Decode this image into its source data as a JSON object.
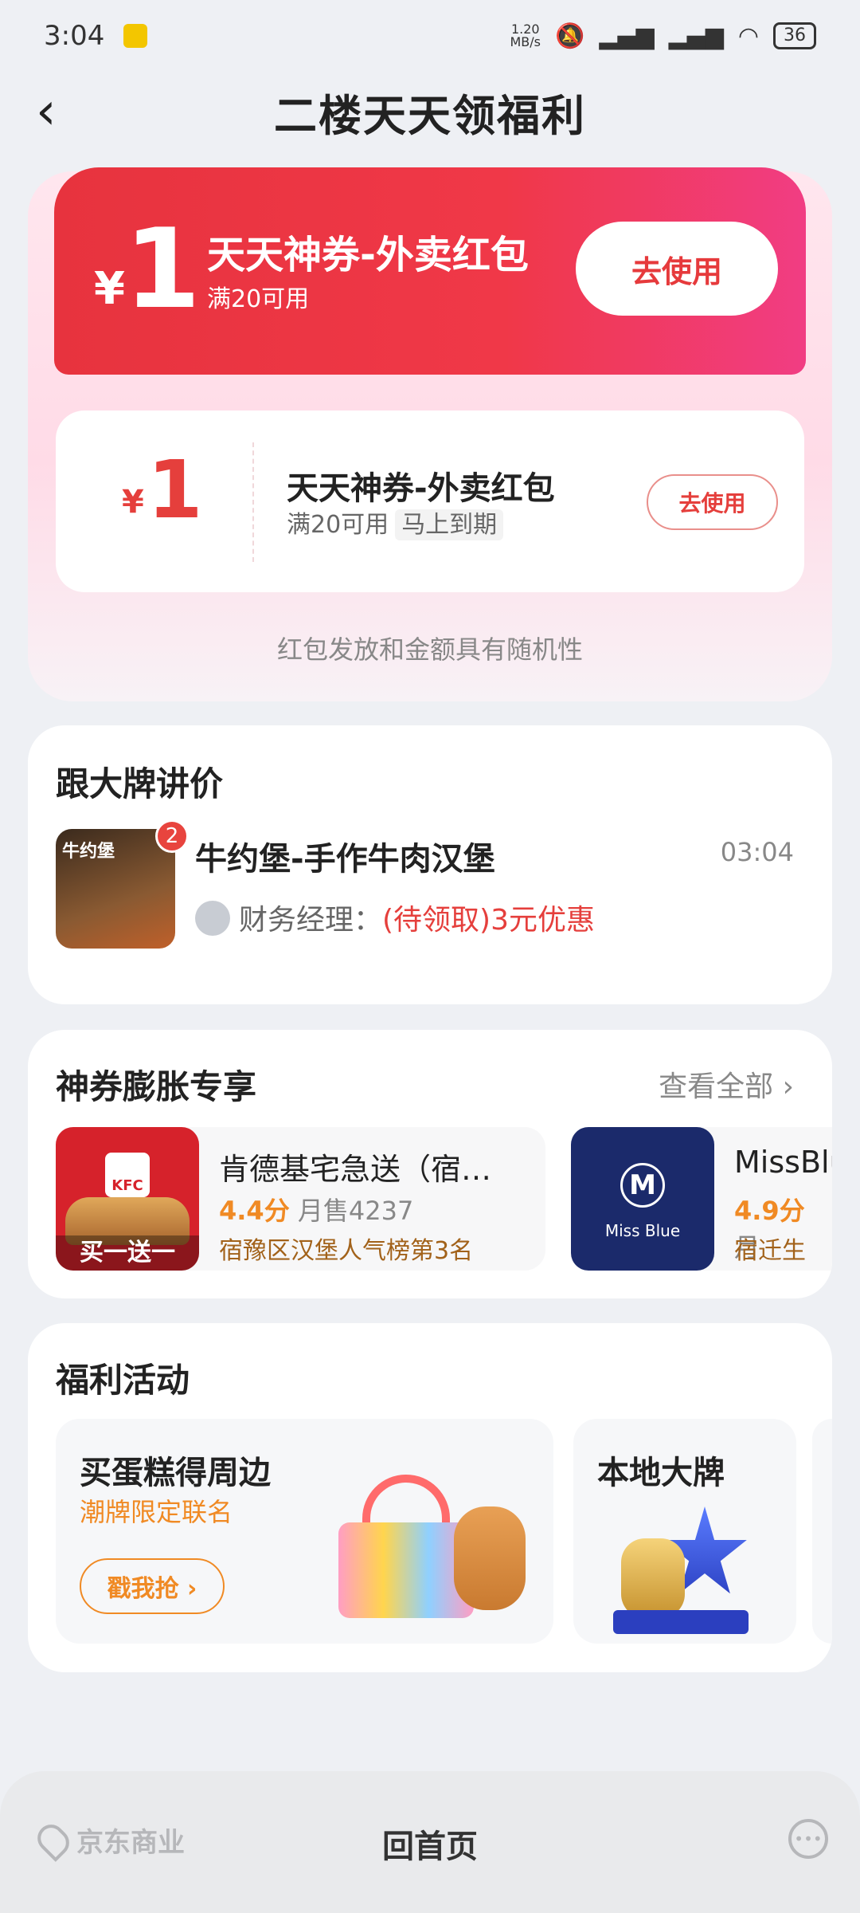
{
  "status_bar": {
    "time": "3:04",
    "net_speed": "1.20\nMB/s",
    "battery": "36"
  },
  "header": {
    "back_icon": "chevron-left-icon",
    "title": "二楼天天领福利"
  },
  "top_coupon": {
    "yen": "¥",
    "amount": "1",
    "name": "天天神券-外卖红包",
    "condition": "满20可用",
    "button": "去使用"
  },
  "second_coupon": {
    "yen": "¥",
    "amount": "1",
    "name": "天天神券-外卖红包",
    "condition": "满20可用",
    "tag": "马上到期",
    "button": "去使用"
  },
  "coupon_note": "红包发放和金额具有随机性",
  "brand_section": {
    "title": "跟大牌讲价",
    "item": {
      "badge": "2",
      "image_label": "牛约堡",
      "name": "牛约堡-手作牛肉汉堡",
      "time": "03:04",
      "sender": "财务经理：",
      "highlight": "(待领取)3元优惠"
    }
  },
  "shop_section": {
    "title": "神券膨胀专享",
    "see_all": "查看全部 ›",
    "shops": [
      {
        "name": "肯德基宅急送（宿…",
        "rating": "4.4分",
        "sales": "月售4237",
        "rank": "宿豫区汉堡人气榜第3名",
        "logo": "KFC",
        "promo": "买一送一"
      },
      {
        "name": "MissBlu",
        "rating": "4.9分",
        "sales": "月",
        "rank": "宿迁生",
        "logo_letter": "M",
        "logo_text": "Miss Blue"
      }
    ]
  },
  "activity_section": {
    "title": "福利活动",
    "items": [
      {
        "title": "买蛋糕得周边",
        "subtitle": "潮牌限定联名",
        "button": "戳我抢 ›"
      },
      {
        "title": "本地大牌"
      }
    ]
  },
  "bottom_bar": {
    "left_label": "京东商业",
    "center_label": "回首页"
  },
  "colors": {
    "accent_red": "#e53f3c",
    "orange": "#f08a24",
    "bg": "#eef0f4"
  }
}
